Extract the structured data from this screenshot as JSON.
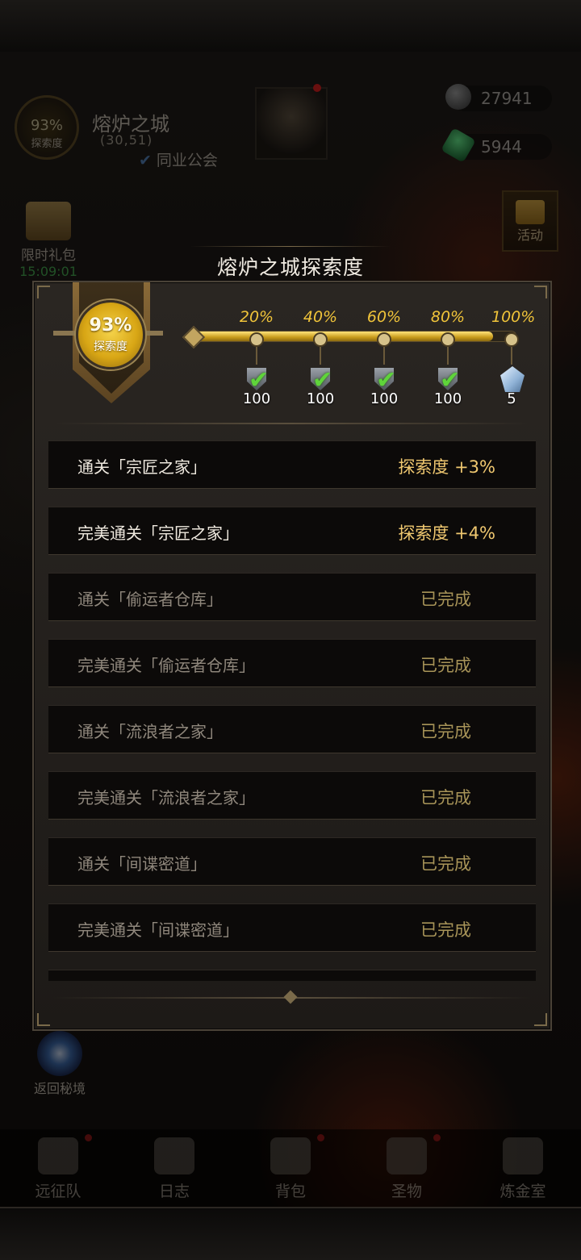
{
  "hud": {
    "explore_pct": "93%",
    "explore_label": "探索度",
    "city_name": "熔炉之城",
    "coords": "(30,51)",
    "guild": "同业公会",
    "currency1": "27941",
    "currency2": "5944",
    "gift_label": "限时礼包",
    "gift_timer": "15:09:01",
    "activity_label": "活动",
    "return_label": "返回秘境"
  },
  "modal": {
    "title": "熔炉之城探索度",
    "badge_pct": "93%",
    "badge_label": "探索度",
    "progress": 0.93,
    "milestones": [
      {
        "pct": "20%",
        "amount": "100",
        "claimed": true,
        "reward_icon": "shield-token-icon"
      },
      {
        "pct": "40%",
        "amount": "100",
        "claimed": true,
        "reward_icon": "shield-token-icon"
      },
      {
        "pct": "60%",
        "amount": "100",
        "claimed": true,
        "reward_icon": "shield-token-icon"
      },
      {
        "pct": "80%",
        "amount": "100",
        "claimed": true,
        "reward_icon": "shield-token-icon"
      },
      {
        "pct": "100%",
        "amount": "5",
        "claimed": false,
        "reward_icon": "crystal-icon"
      }
    ],
    "tasks": [
      {
        "task": "通关「宗匠之家」",
        "reward": "探索度 +3%",
        "done": false
      },
      {
        "task": "完美通关「宗匠之家」",
        "reward": "探索度 +4%",
        "done": false
      },
      {
        "task": "通关「偷运者仓库」",
        "reward": "已完成",
        "done": true
      },
      {
        "task": "完美通关「偷运者仓库」",
        "reward": "已完成",
        "done": true
      },
      {
        "task": "通关「流浪者之家」",
        "reward": "已完成",
        "done": true
      },
      {
        "task": "完美通关「流浪者之家」",
        "reward": "已完成",
        "done": true
      },
      {
        "task": "通关「间谍密道」",
        "reward": "已完成",
        "done": true
      },
      {
        "task": "完美通关「间谍密道」",
        "reward": "已完成",
        "done": true
      }
    ]
  },
  "nav": [
    {
      "label": "远征队",
      "icon": "helmet-icon",
      "dot": true
    },
    {
      "label": "日志",
      "icon": "map-scroll-icon",
      "dot": false
    },
    {
      "label": "背包",
      "icon": "backpack-icon",
      "dot": true
    },
    {
      "label": "圣物",
      "icon": "chalice-icon",
      "dot": true
    },
    {
      "label": "炼金室",
      "icon": "alchemy-icon",
      "dot": false
    }
  ],
  "colors": {
    "accent_gold": "#f0c43a",
    "done_text": "#8f877c",
    "timer_green": "#4bc65b",
    "check_green": "#5fd43a"
  }
}
